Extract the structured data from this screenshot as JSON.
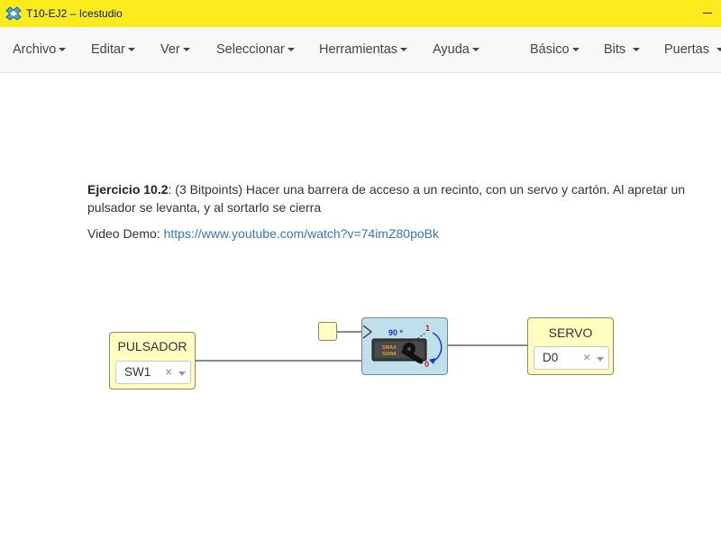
{
  "window": {
    "title": "T10-EJ2 – Icestudio",
    "app_icon": "icestudio-logo-icon"
  },
  "menu": {
    "left": [
      {
        "label": "Archivo"
      },
      {
        "label": "Editar"
      },
      {
        "label": "Ver"
      },
      {
        "label": "Seleccionar"
      },
      {
        "label": "Herramientas"
      },
      {
        "label": "Ayuda"
      }
    ],
    "right": [
      {
        "label": "Básico"
      },
      {
        "label": "Bits"
      },
      {
        "label": "Puertas"
      }
    ]
  },
  "description": {
    "title": "Ejercicio 10.2",
    "text": ": (3 Bitpoints) Hacer una barrera de acceso a un recinto, con un servo y cartón. Al apretar un pulsador se levanta, y al sortarlo se cierra",
    "video_label": "Video Demo: ",
    "video_url": "https://www.youtube.com/watch?v=74imZ80poBk"
  },
  "blocks": {
    "input": {
      "title": "PULSADOR",
      "pin": "SW1",
      "clear": "×"
    },
    "servo": {
      "angle_label": "90 º",
      "pos_1": "1",
      "pos_0": "0",
      "chip_line1": "SMAX",
      "chip_line2": "SSMA"
    },
    "output": {
      "title": "SERVO",
      "pin": "D0",
      "clear": "×"
    }
  },
  "colors": {
    "titlebar": "#fcec1e",
    "io_block": "#fffdbf",
    "servo_block": "#bfe0ea",
    "link": "#337ab7"
  }
}
